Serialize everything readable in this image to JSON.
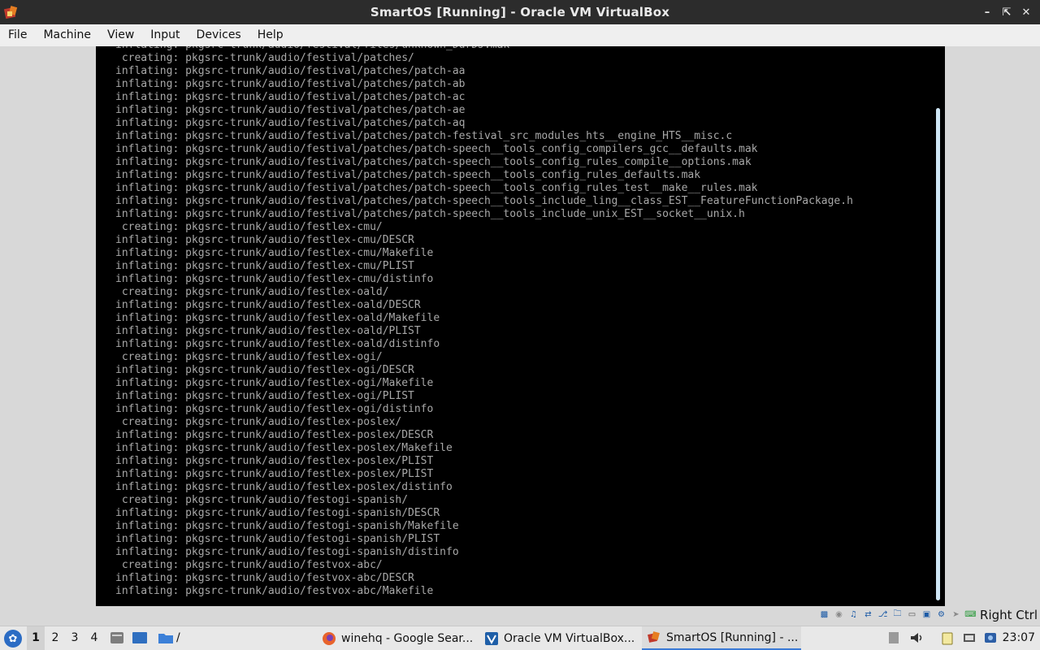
{
  "window": {
    "title": "SmartOS [Running] - Oracle VM VirtualBox",
    "app_icon": "virtualbox-icon",
    "controls": [
      "minimize-icon",
      "restore-icon",
      "close-icon"
    ]
  },
  "menubar": {
    "items": [
      "File",
      "Machine",
      "View",
      "Input",
      "Devices",
      "Help"
    ]
  },
  "terminal": {
    "lines": [
      "inflating: pkgsrc-trunk/audio/festival/files/unknown_DurDJ.mak",
      " creating: pkgsrc-trunk/audio/festival/patches/",
      "inflating: pkgsrc-trunk/audio/festival/patches/patch-aa",
      "inflating: pkgsrc-trunk/audio/festival/patches/patch-ab",
      "inflating: pkgsrc-trunk/audio/festival/patches/patch-ac",
      "inflating: pkgsrc-trunk/audio/festival/patches/patch-ae",
      "inflating: pkgsrc-trunk/audio/festival/patches/patch-aq",
      "inflating: pkgsrc-trunk/audio/festival/patches/patch-festival_src_modules_hts__engine_HTS__misc.c",
      "inflating: pkgsrc-trunk/audio/festival/patches/patch-speech__tools_config_compilers_gcc__defaults.mak",
      "inflating: pkgsrc-trunk/audio/festival/patches/patch-speech__tools_config_rules_compile__options.mak",
      "inflating: pkgsrc-trunk/audio/festival/patches/patch-speech__tools_config_rules_defaults.mak",
      "inflating: pkgsrc-trunk/audio/festival/patches/patch-speech__tools_config_rules_test__make__rules.mak",
      "inflating: pkgsrc-trunk/audio/festival/patches/patch-speech__tools_include_ling__class_EST__FeatureFunctionPackage.h",
      "inflating: pkgsrc-trunk/audio/festival/patches/patch-speech__tools_include_unix_EST__socket__unix.h",
      " creating: pkgsrc-trunk/audio/festlex-cmu/",
      "inflating: pkgsrc-trunk/audio/festlex-cmu/DESCR",
      "inflating: pkgsrc-trunk/audio/festlex-cmu/Makefile",
      "inflating: pkgsrc-trunk/audio/festlex-cmu/PLIST",
      "inflating: pkgsrc-trunk/audio/festlex-cmu/distinfo",
      " creating: pkgsrc-trunk/audio/festlex-oald/",
      "inflating: pkgsrc-trunk/audio/festlex-oald/DESCR",
      "inflating: pkgsrc-trunk/audio/festlex-oald/Makefile",
      "inflating: pkgsrc-trunk/audio/festlex-oald/PLIST",
      "inflating: pkgsrc-trunk/audio/festlex-oald/distinfo",
      " creating: pkgsrc-trunk/audio/festlex-ogi/",
      "inflating: pkgsrc-trunk/audio/festlex-ogi/DESCR",
      "inflating: pkgsrc-trunk/audio/festlex-ogi/Makefile",
      "inflating: pkgsrc-trunk/audio/festlex-ogi/PLIST",
      "inflating: pkgsrc-trunk/audio/festlex-ogi/distinfo",
      " creating: pkgsrc-trunk/audio/festlex-poslex/",
      "inflating: pkgsrc-trunk/audio/festlex-poslex/DESCR",
      "inflating: pkgsrc-trunk/audio/festlex-poslex/Makefile",
      "inflating: pkgsrc-trunk/audio/festlex-poslex/PLIST",
      "inflating: pkgsrc-trunk/audio/festlex-poslex/PLIST",
      "inflating: pkgsrc-trunk/audio/festlex-poslex/distinfo",
      " creating: pkgsrc-trunk/audio/festogi-spanish/",
      "inflating: pkgsrc-trunk/audio/festogi-spanish/DESCR",
      "inflating: pkgsrc-trunk/audio/festogi-spanish/Makefile",
      "inflating: pkgsrc-trunk/audio/festogi-spanish/PLIST",
      "inflating: pkgsrc-trunk/audio/festogi-spanish/distinfo",
      " creating: pkgsrc-trunk/audio/festvox-abc/",
      "inflating: pkgsrc-trunk/audio/festvox-abc/DESCR",
      "inflating: pkgsrc-trunk/audio/festvox-abc/Makefile"
    ]
  },
  "statusbar": {
    "indicator_icons": [
      "hard-disk-icon",
      "optical-drive-icon",
      "audio-icon",
      "network-icon",
      "usb-icon",
      "shared-folders-icon",
      "display-icon",
      "video-capture-icon",
      "cpu-icon",
      "mouse-integration-icon",
      "keyboard-icon"
    ],
    "host_key": "Right Ctrl"
  },
  "taskbar": {
    "workspaces": [
      "1",
      "2",
      "3",
      "4"
    ],
    "active_workspace": "1",
    "quick_launch": [
      "file-manager-icon",
      "desktop-icon",
      "folder-icon"
    ],
    "quick_launch_label": "/",
    "tasks": [
      {
        "label": "winehq - Google Sear...",
        "icon": "firefox-icon"
      },
      {
        "label": "Oracle VM VirtualBox...",
        "icon": "virtualbox-manager-icon"
      },
      {
        "label": "SmartOS [Running] - ...",
        "icon": "virtualbox-icon"
      }
    ],
    "tray_icons": [
      "notes-icon",
      "volume-icon",
      "clipboard-icon",
      "network-tray-icon",
      "bluetooth-icon"
    ],
    "clock": "23:07"
  }
}
